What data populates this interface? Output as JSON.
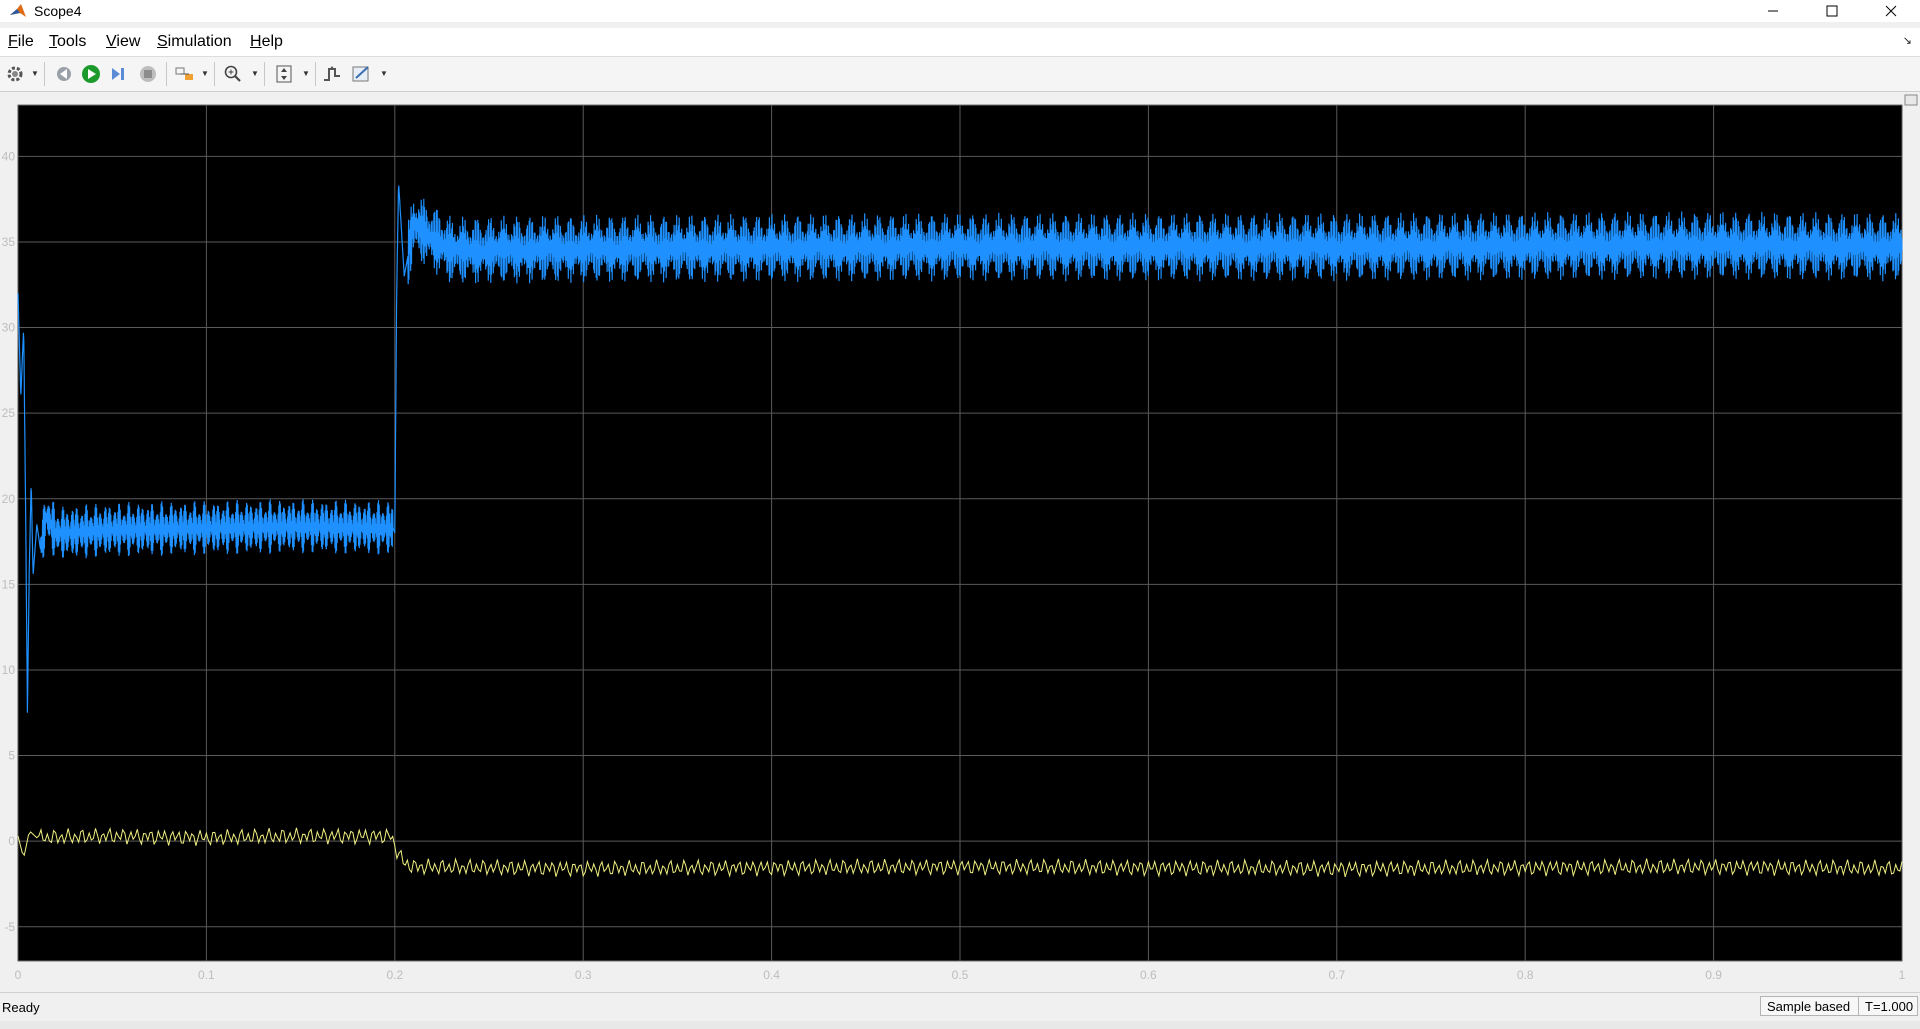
{
  "window": {
    "title": "Scope4",
    "app_icon": "matlab-icon",
    "controls": [
      "minimize-icon",
      "maximize-icon",
      "close-icon"
    ]
  },
  "menu": {
    "items": [
      {
        "label": "File",
        "mnemonic": "F"
      },
      {
        "label": "Tools",
        "mnemonic": "T"
      },
      {
        "label": "View",
        "mnemonic": "V"
      },
      {
        "label": "Simulation",
        "mnemonic": "S"
      },
      {
        "label": "Help",
        "mnemonic": "H"
      }
    ]
  },
  "toolbar": {
    "icons": [
      "settings-gear-icon",
      "step-back-icon",
      "run-icon",
      "step-forward-icon",
      "stop-icon",
      "highlight-signal-icon",
      "zoom-in-icon",
      "fit-to-view-icon",
      "triggers-icon",
      "style-icon"
    ]
  },
  "colors": {
    "plot_background": "#000000",
    "grid": "#5a5a5a",
    "axis_text": "#bdbdbd",
    "series_blue": "#1e90ff",
    "series_yellow": "#f0f080"
  },
  "chart_data": {
    "type": "line",
    "title": "",
    "xlabel": "",
    "ylabel": "",
    "xlim": [
      0,
      1
    ],
    "ylim": [
      -7,
      43
    ],
    "x_ticks": [
      0,
      0.1,
      0.2,
      0.3,
      0.4,
      0.5,
      0.6,
      0.7,
      0.8,
      0.9,
      1
    ],
    "x_tick_labels": [
      "0",
      "0.1",
      "0.2",
      "0.3",
      "0.4",
      "0.5",
      "0.6",
      "0.7",
      "0.8",
      "0.9",
      "1"
    ],
    "y_ticks": [
      -5,
      0,
      5,
      10,
      15,
      20,
      25,
      30,
      35,
      40
    ],
    "y_tick_labels": [
      "-5",
      "0",
      "5",
      "10",
      "15",
      "20",
      "25",
      "30",
      "35",
      "40"
    ],
    "grid": true,
    "series": [
      {
        "color": "#1e90ff",
        "x": [
          0,
          0.0015,
          0.003,
          0.004,
          0.005,
          0.006,
          0.007,
          0.008,
          0.01,
          0.012,
          0.015,
          0.02,
          0.05,
          0.1,
          0.15,
          0.199,
          0.2,
          0.201,
          0.202,
          0.205,
          0.21,
          0.23,
          0.3,
          0.5,
          0.7,
          0.9,
          1.0
        ],
        "y": [
          32,
          26,
          30,
          20,
          7.5,
          16,
          21,
          15.5,
          18.5,
          17,
          19,
          18,
          18.2,
          18.3,
          18.4,
          18.3,
          18,
          32,
          38.5,
          33,
          36,
          34.5,
          34.6,
          34.7,
          34.7,
          34.8,
          34.7
        ],
        "band_half_width": {
          "before_0.2": 1.6,
          "after_0.2": 2.0
        }
      },
      {
        "color": "#f0f080",
        "x": [
          0,
          0.003,
          0.006,
          0.01,
          0.05,
          0.1,
          0.15,
          0.198,
          0.2,
          0.205,
          0.21,
          0.3,
          0.5,
          0.7,
          0.9,
          1.0
        ],
        "y": [
          0.3,
          -1.0,
          0.6,
          0.2,
          0.3,
          0.2,
          0.3,
          0.3,
          -0.3,
          -1.3,
          -1.5,
          -1.6,
          -1.5,
          -1.6,
          -1.5,
          -1.6
        ]
      }
    ]
  },
  "status": {
    "left": "Ready",
    "mode": "Sample based",
    "time": "T=1.000"
  }
}
